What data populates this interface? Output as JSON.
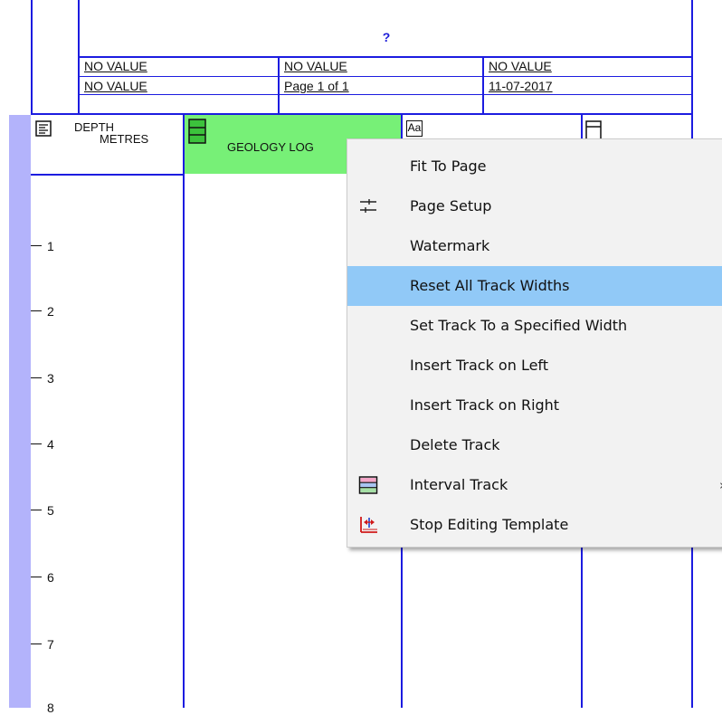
{
  "header": {
    "title": "?",
    "row1": [
      "NO VALUE",
      "NO VALUE",
      "NO VALUE"
    ],
    "row2": [
      "NO VALUE",
      "Page 1 of 1",
      "11-07-2017"
    ]
  },
  "tracks": {
    "depth": {
      "label_line1": "DEPTH",
      "label_line2": "METRES",
      "icon": "text-track-icon"
    },
    "geology": {
      "label": "GEOLOGY LOG",
      "icon": "geology-track-icon",
      "highlight_color": "#77f077"
    },
    "text": {
      "label": "Aa",
      "icon": "text-style-icon"
    },
    "blank": {
      "icon": "empty-track-icon"
    }
  },
  "ruler": {
    "ticks": [
      "1",
      "2",
      "3",
      "4",
      "5",
      "6",
      "7",
      "8"
    ]
  },
  "context_menu": {
    "items": [
      {
        "label": "Fit To Page",
        "icon": ""
      },
      {
        "label": "Page Setup",
        "icon": "sliders-icon"
      },
      {
        "label": "Watermark",
        "icon": ""
      },
      {
        "label": "Reset All Track Widths",
        "icon": "",
        "highlighted": true
      },
      {
        "label": "Set Track To a Specified Width",
        "icon": ""
      },
      {
        "label": "Insert Track on Left",
        "icon": ""
      },
      {
        "label": "Insert Track on Right",
        "icon": ""
      },
      {
        "label": "Delete Track",
        "icon": ""
      },
      {
        "label": "Interval Track",
        "icon": "interval-track-icon",
        "submenu": true,
        "arrow": "›"
      },
      {
        "label": "Stop Editing Template",
        "icon": "stop-editing-icon"
      }
    ]
  },
  "colors": {
    "grid": "#1c1ce0",
    "side_strip": "#b3b3fb",
    "highlight": "#91c9f7"
  }
}
